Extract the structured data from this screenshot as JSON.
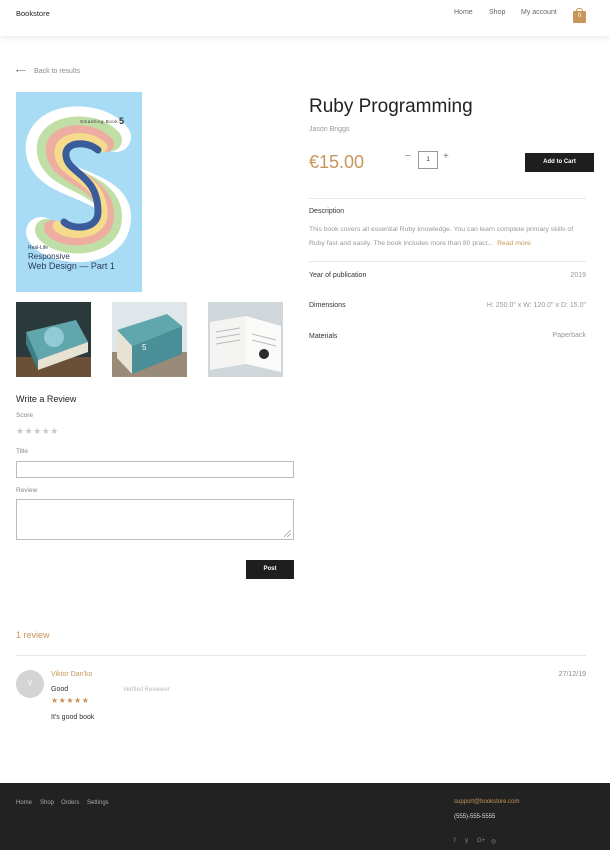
{
  "header": {
    "brand": "Bookstore",
    "nav": [
      "Home",
      "Shop",
      "My account"
    ],
    "cart_count": "0",
    "accent_color": "#c8955a"
  },
  "back_link": "Back to results",
  "cover": {
    "series": "Smashing Book",
    "number": "5",
    "line1": "Real-Life",
    "line2": "Responsive",
    "line3": "Web Design — Part 1"
  },
  "product": {
    "title": "Ruby Programming",
    "author": "Jason Briggs",
    "price": "€15.00",
    "quantity": "1",
    "qty_minus": "−",
    "qty_plus": "+",
    "add_to_cart": "Add to Cart",
    "description_label": "Description",
    "description": "This book covers all essential Ruby knowledge. You can learn complete primary skills of Ruby fast and easily. The book includes more than 80 pract...",
    "read_more": "Read more",
    "specs": [
      {
        "label": "Year of publication",
        "value": "2019"
      },
      {
        "label": "Dimensions",
        "value": "H: 250.0\" x W: 120.0\" x D: 15.0\""
      },
      {
        "label": "Materials",
        "value": "Paperback"
      }
    ]
  },
  "review_form": {
    "heading": "Write a Review",
    "score_label": "Score",
    "empty_stars": "★★★★★",
    "title_label": "Title",
    "review_label": "Review",
    "post_button": "Post"
  },
  "reviews": {
    "count_label": "1 review",
    "items": [
      {
        "initial": "V",
        "name": "Viktor Dan'ko",
        "title": "Good",
        "verified": "Verified Reviewer",
        "stars": "★★★★★",
        "date": "27/12/19",
        "body": "It's good book"
      }
    ]
  },
  "footer": {
    "links": [
      "Home",
      "Shop",
      "Orders",
      "Settings"
    ],
    "email": "support@bookstore.com",
    "phone": "(555)-555-5555",
    "social": [
      "f",
      "y",
      "G+",
      "◎"
    ]
  }
}
